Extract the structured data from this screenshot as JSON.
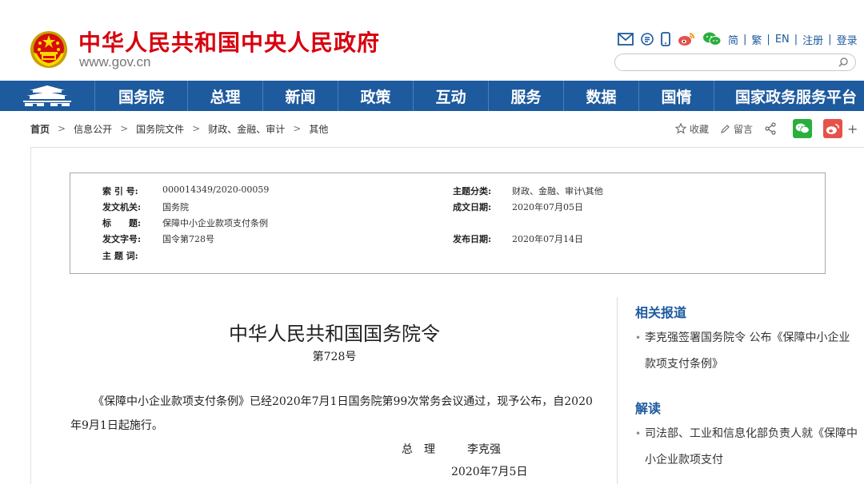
{
  "header": {
    "site_title": "中华人民共和国中央人民政府",
    "site_url": "www.gov.cn",
    "tools": [
      "简",
      "繁",
      "EN",
      "注册",
      "登录"
    ],
    "search_placeholder": "",
    "icons": [
      "mail-icon",
      "rss-icon",
      "mobile-icon",
      "weibo-icon",
      "wechat-icon"
    ]
  },
  "nav": {
    "items": [
      "国务院",
      "总理",
      "新闻",
      "政策",
      "互动",
      "服务",
      "数据",
      "国情",
      "国家政务服务平台"
    ]
  },
  "breadcrumb": {
    "items": [
      "首页",
      "信息公开",
      "国务院文件",
      "财政、金融、审计",
      "其他"
    ],
    "separator": ">"
  },
  "share": {
    "favorite": "收藏",
    "comment": "留言",
    "more": "+"
  },
  "meta": {
    "index_label": "索 引 号:",
    "index_value": "000014349/2020-00059",
    "category_label": "主题分类:",
    "category_value": "财政、金融、审计\\其他",
    "issuer_label": "发文机关:",
    "issuer_value": "国务院",
    "written_label": "成文日期:",
    "written_value": "2020年07月05日",
    "title_label": "标       题:",
    "title_value": "保障中小企业款项支付条例",
    "docno_label": "发文字号:",
    "docno_value": "国令第728号",
    "published_label": "发布日期:",
    "published_value": "2020年07月14日",
    "keywords_label": "主 题 词:",
    "keywords_value": ""
  },
  "article": {
    "title": "中华人民共和国国务院令",
    "number": "第728号",
    "body": "《保障中小企业款项支付条例》已经2020年7月1日国务院第99次常务会议通过，现予公布，自2020年9月1日起施行。",
    "sign_title": "总　理",
    "sign_name": "李克强",
    "sign_date": "2020年7月5日"
  },
  "sidebar": {
    "related_heading": "相关报道",
    "related_items": [
      "李克强签署国务院令 公布《保障中小企业款项支付条例》"
    ],
    "interpret_heading": "解读",
    "interpret_items": [
      "司法部、工业和信息化部负责人就《保障中小企业款项支付"
    ],
    "bullet": "•"
  },
  "colors": {
    "brand_red": "#d7000f",
    "nav_blue": "#1d5a9e",
    "wechat_green": "#2aae3e",
    "weibo_red": "#e6524a"
  }
}
